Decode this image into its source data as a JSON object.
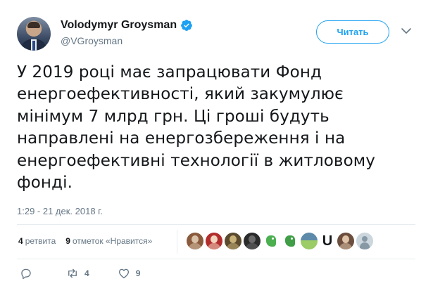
{
  "author": {
    "display_name": "Volodymyr Groysman",
    "handle": "@VGroysman",
    "verified": true
  },
  "follow_button": {
    "label": "Читать"
  },
  "tweet": {
    "lines": [
      "У 2019 році має запрацювати Фонд",
      "енергоефективності, який закумулює",
      "мінімум 7 млрд грн. Ці гроші будуть",
      "направлені на енергозбереження і на",
      "енергоефективні технології в житловому",
      "фонді."
    ],
    "timestamp": "1:29 - 21 дек. 2018 г."
  },
  "stats": {
    "retweets_count": "4",
    "retweets_label": "ретвита",
    "likes_count": "9",
    "likes_label": "отметок «Нравится»"
  },
  "likers": [
    {
      "kind": "avatar",
      "icon": "liker-avatar-1",
      "colors": [
        "#8a5a3c",
        "#d9c2a8"
      ]
    },
    {
      "kind": "avatar",
      "icon": "liker-avatar-2",
      "colors": [
        "#b32d2d",
        "#f0d6c0"
      ]
    },
    {
      "kind": "avatar",
      "icon": "liker-avatar-3",
      "colors": [
        "#5b4a2e",
        "#c8b27a"
      ]
    },
    {
      "kind": "avatar",
      "icon": "liker-avatar-4",
      "colors": [
        "#2b2b2b",
        "#6b6b6b"
      ]
    },
    {
      "kind": "avatar",
      "icon": "liker-avatar-dragon-1",
      "colors": [
        "#4caf50",
        "#ffffff"
      ]
    },
    {
      "kind": "avatar",
      "icon": "liker-avatar-dragon-2",
      "colors": [
        "#3f9e46",
        "#ffffff"
      ]
    },
    {
      "kind": "avatar",
      "icon": "liker-avatar-landscape",
      "colors": [
        "#9ccc65",
        "#5d8aa8"
      ]
    },
    {
      "kind": "letter",
      "icon": "liker-avatar-letter",
      "text": "U"
    },
    {
      "kind": "avatar",
      "icon": "liker-avatar-person",
      "colors": [
        "#6b4e3d",
        "#e0c3a8"
      ]
    },
    {
      "kind": "avatar",
      "icon": "liker-avatar-default",
      "colors": [
        "#ccd6dd",
        "#8899a6"
      ]
    }
  ],
  "actions": {
    "reply_count": "",
    "retweet_count": "4",
    "like_count": "9"
  },
  "colors": {
    "accent": "#1da1f2",
    "muted": "#657786",
    "text": "#14171a",
    "divider": "#e6ecf0"
  }
}
